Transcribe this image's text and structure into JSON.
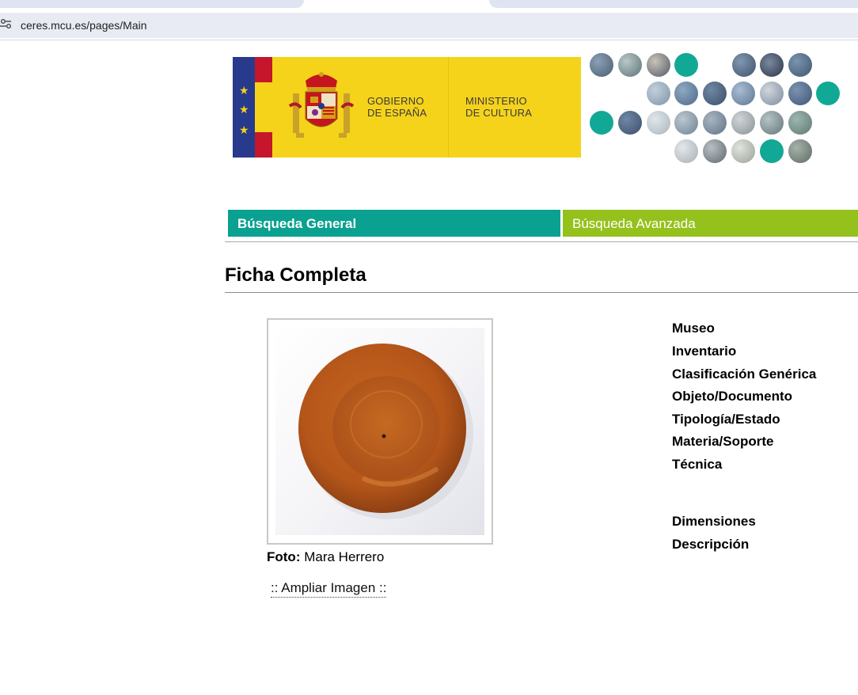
{
  "browser": {
    "url": "ceres.mcu.es/pages/Main",
    "site_info_icon": "tune-icon"
  },
  "banner": {
    "gobierno_line1": "GOBIERNO",
    "gobierno_line2": "DE ESPAÑA",
    "ministerio_line1": "MINISTERIO",
    "ministerio_line2": "DE CULTURA",
    "colors": {
      "yellow": "#f5d31b",
      "flag_red": "#c6162b",
      "flag_blue": "#273a8c"
    }
  },
  "nav": {
    "general": "Búsqueda General",
    "avanzada": "Búsqueda Avanzada",
    "colors": {
      "general": "#0aa191",
      "avanzada": "#95c11c"
    }
  },
  "page": {
    "title": "Ficha Completa"
  },
  "photo": {
    "credit_label": "Foto:",
    "credit_name": "Mara Herrero",
    "ampliar": ":: Ampliar Imagen ::"
  },
  "fields": [
    "Museo",
    "Inventario",
    "Clasificación Genérica",
    "Objeto/Documento",
    "Tipología/Estado",
    "Materia/Soporte",
    "Técnica",
    "Dimensiones",
    "Descripción"
  ]
}
